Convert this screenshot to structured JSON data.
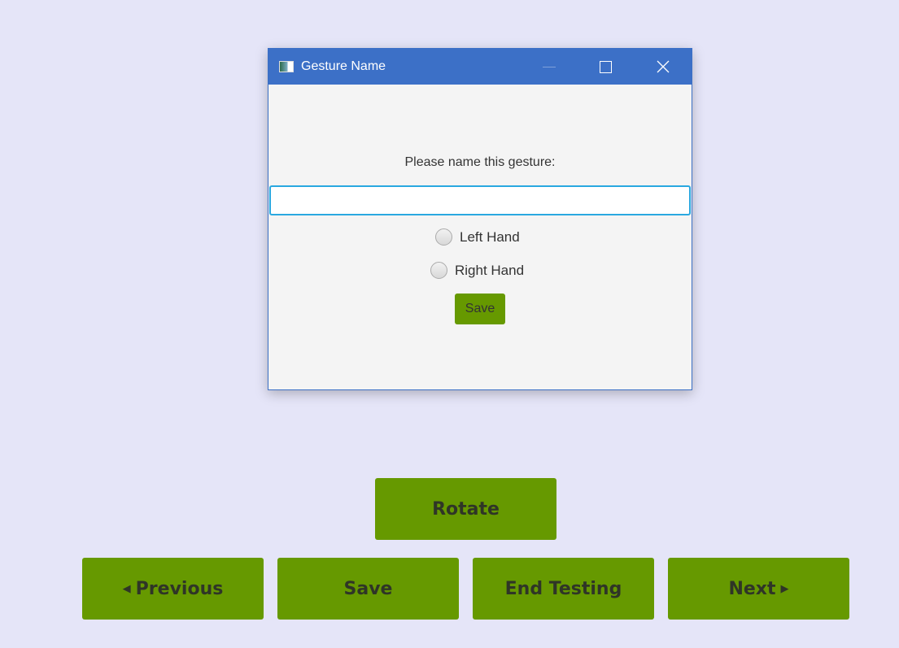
{
  "dialog": {
    "title": "Gesture Name",
    "icon": "app-window-icon",
    "prompt": "Please name this gesture:",
    "name_input": {
      "value": "",
      "placeholder": ""
    },
    "radios": [
      {
        "label": "Left Hand",
        "selected": false
      },
      {
        "label": "Right Hand",
        "selected": false
      }
    ],
    "save_label": "Save"
  },
  "buttons": {
    "rotate": "Rotate",
    "previous": "Previous",
    "save": "Save",
    "end_testing": "End Testing",
    "next": "Next"
  },
  "colors": {
    "background": "#e5e5f8",
    "button_green": "#669900",
    "titlebar": "#3c70c7",
    "focus": "#2aa8e0"
  }
}
